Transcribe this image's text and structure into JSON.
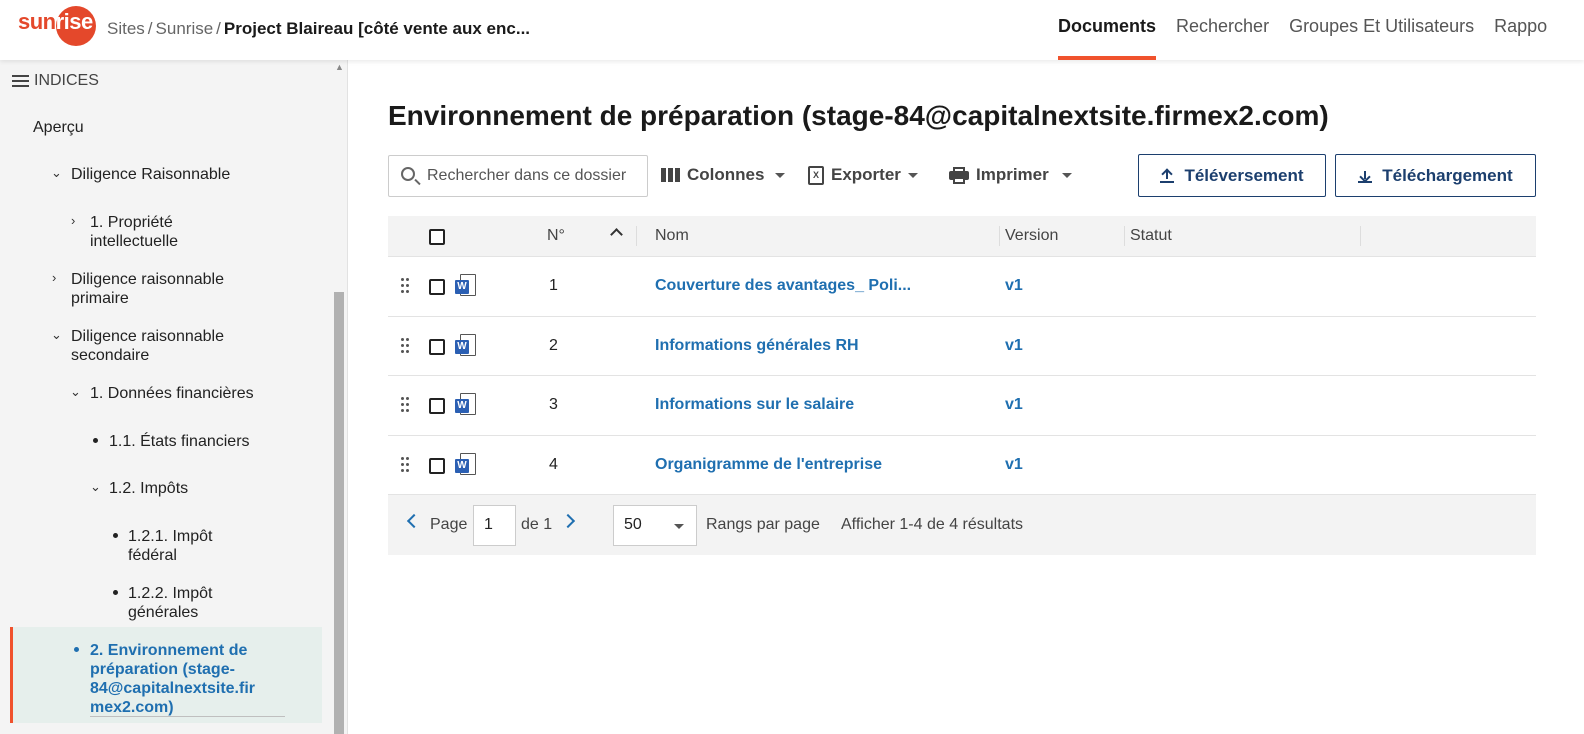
{
  "brand": {
    "logo_text_a": "sun",
    "logo_text_b": "rise",
    "accent": "#f0522d",
    "link_color": "#1f6fb0",
    "button_color": "#1c3f6e"
  },
  "breadcrumb": {
    "part1": "Sites",
    "part2": "Sunrise",
    "current": "Project Blaireau [côté vente aux enc..."
  },
  "topnav": [
    "Documents",
    "Rechercher",
    "Groupes Et Utilisateurs",
    "Rappo"
  ],
  "sidebar": {
    "title": "INDICES",
    "items": [
      "Aperçu",
      "Diligence Raisonnable",
      "1. Propriété",
      "intellectuelle",
      "Diligence raisonnable",
      "primaire",
      "Diligence raisonnable",
      "secondaire",
      "1. Données financières",
      "1.1. États financiers",
      "1.2. Impôts",
      "1.2.1. Impôt",
      "fédéral",
      "1.2.2. Impôt",
      "générales"
    ],
    "active_lines": [
      "2. Environnement de",
      "préparation (stage-",
      "84@capitalnextsite.fir",
      "mex2.com)"
    ]
  },
  "main": {
    "title": "Environnement de préparation (stage-84@capitalnextsite.firmex2.com)",
    "search_placeholder": "Rechercher dans ce dossier",
    "toolbar": {
      "columns": "Colonnes",
      "export": "Exporter",
      "print": "Imprimer",
      "upload": "Téléversement",
      "download": "Téléchargement"
    }
  },
  "table": {
    "headers": {
      "num": "N°",
      "name": "Nom",
      "version": "Version",
      "status": "Statut"
    },
    "rows": [
      {
        "num": "1",
        "name": "Couverture des avantages_ Poli...",
        "version": "v1",
        "status": ""
      },
      {
        "num": "2",
        "name": "Informations générales RH",
        "version": "v1",
        "status": ""
      },
      {
        "num": "3",
        "name": "Informations sur le salaire",
        "version": "v1",
        "status": ""
      },
      {
        "num": "4",
        "name": "Organigramme de l'entreprise",
        "version": "v1",
        "status": ""
      }
    ]
  },
  "pagination": {
    "page_label": "Page",
    "page_value": "1",
    "of_label": "de 1",
    "per_page_value": "50",
    "per_page_label": "Rangs par page",
    "results": "Afficher 1-4 de 4 résultats"
  }
}
